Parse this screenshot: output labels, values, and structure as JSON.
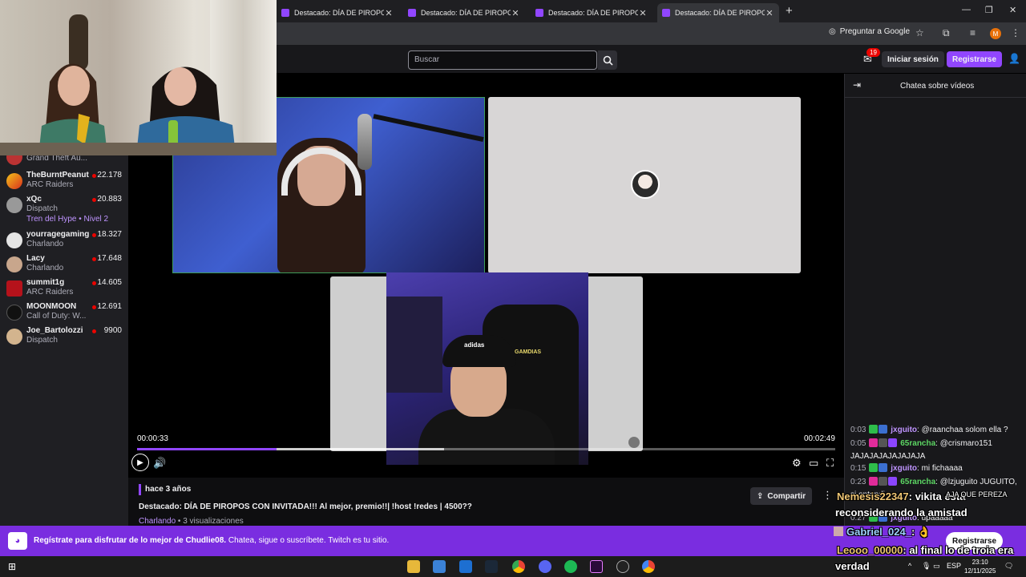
{
  "browser": {
    "tabs": [
      {
        "title": "Destacado: DÍA DE PIROPOS CO",
        "active": false
      },
      {
        "title": "Destacado: DÍA DE PIROPOS CO",
        "active": false
      },
      {
        "title": "Destacado: DÍA DE PIROPOS CO",
        "active": false
      },
      {
        "title": "Destacado: DÍA DE PIROPOS CO",
        "active": true
      }
    ],
    "ask_google": "Preguntar a Google",
    "profile_initial": "M"
  },
  "nav": {
    "search_placeholder": "Buscar",
    "inbox_badge": "19",
    "login_label": "Iniciar sesión",
    "register_label": "Registrarse"
  },
  "sidebar": {
    "top_partial_game": "Grand Theft Au...",
    "channels": [
      {
        "name": "TheBurntPeanut",
        "game": "ARC Raiders",
        "viewers": "22.178",
        "extra": ""
      },
      {
        "name": "xQc",
        "game": "Dispatch",
        "viewers": "20.883",
        "extra": "Tren del Hype • Nivel 2"
      },
      {
        "name": "yourragegaming",
        "game": "Charlando",
        "viewers": "18.327",
        "extra": ""
      },
      {
        "name": "Lacy",
        "game": "Charlando",
        "viewers": "17.648",
        "extra": ""
      },
      {
        "name": "summit1g",
        "game": "ARC Raiders",
        "viewers": "14.605",
        "extra": ""
      },
      {
        "name": "MOONMOON",
        "game": "Call of Duty: W...",
        "viewers": "12.691",
        "extra": ""
      },
      {
        "name": "Joe_Bartolozzi",
        "game": "Dispatch",
        "viewers": "9900",
        "extra": ""
      }
    ]
  },
  "player": {
    "time_current": "00:00:33",
    "time_total": "00:02:49",
    "progress": 0.2,
    "buffered": 0.44,
    "cap_logo": "adidas",
    "chair_text": "GAMDIAS"
  },
  "info": {
    "ago": "hace 3 años",
    "title": "Destacado: DÍA DE PIROPOS CON INVITADA!!! Al mejor, premio!!| !host !redes | 4500??",
    "category": "Charlando",
    "views": " • 3 visualizaciones",
    "share_label": "Compartir"
  },
  "chat": {
    "title": "Chatea sobre vídeos",
    "messages": [
      {
        "ts": "0:03",
        "user": "jxguito",
        "color": "#bf94ff",
        "text": "@raanchaa solom ella ?"
      },
      {
        "ts": "0:05",
        "user": "65rancha",
        "color": "#5cd663",
        "text": "@crismaro151 JAJAJAJAJAJAJAJA"
      },
      {
        "ts": "0:15",
        "user": "jxguito",
        "color": "#bf94ff",
        "text": "mi fichaaaa"
      },
      {
        "ts": "0:23",
        "user": "65rancha",
        "color": "#5cd663",
        "text": "@lzjuguito JUGUITO, si entendi"
      },
      {
        "ts": "0:27",
        "user": "jxguito",
        "color": "#bf94ff",
        "text": "upaaaaa"
      }
    ]
  },
  "overlay_chat": {
    "line1_user": "Nemesis22347",
    "line1_text": ": vikita esta",
    "line2_text": "reconsiderando la amistad",
    "line2_extra": "AJA QUE PEREZA",
    "line3_user": "Gabriel_024_",
    "line3_text": ":",
    "line4_user": "Leooo_00000",
    "line4_text": ": al final lo de troia era",
    "line5_text": "verdad"
  },
  "banner": {
    "strong": "Regístrate para disfrutar de lo mejor de Chudlie08.",
    "rest": " Chatea, sigue o suscríbete. Twitch es tu sitio.",
    "button": "Registrarse"
  },
  "taskbar": {
    "lang": "ESP",
    "time": "23:10",
    "date": "12/11/2025"
  }
}
